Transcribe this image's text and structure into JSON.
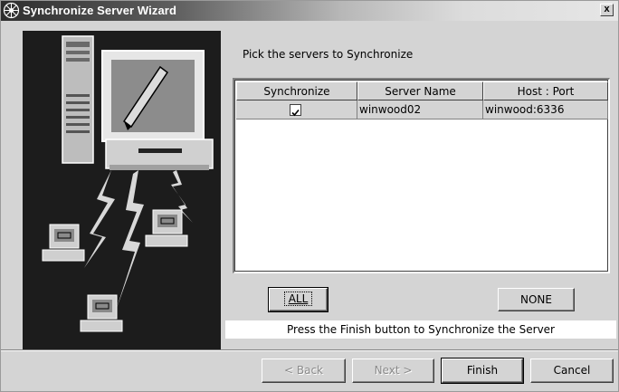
{
  "window": {
    "title": "Synchronize Server Wizard",
    "close_label": "x"
  },
  "main": {
    "instruction": "Pick the servers to Synchronize",
    "table": {
      "columns": [
        "Synchronize",
        "Server Name",
        "Host : Port"
      ],
      "rows": [
        {
          "synchronize": true,
          "check_glyph": "☑",
          "server_name": "winwood02",
          "host_port": "winwood:6336"
        }
      ]
    },
    "all_button": "ALL",
    "none_button": "NONE",
    "status_text": "Press the Finish button to Synchronize the  Server"
  },
  "footer": {
    "back_button": "< Back",
    "next_button": "Next >",
    "finish_button": "Finish",
    "cancel_button": "Cancel"
  },
  "icons": {
    "title_icon": "wizard-icon",
    "close": "close-icon",
    "checkbox": "checkmark-icon"
  },
  "colors": {
    "dialog_bg": "#d4d4d4",
    "title_gradient_start": "#2e2e2e",
    "title_gradient_end": "#e6e6e6",
    "illustration_bg": "#1a1a1a"
  }
}
